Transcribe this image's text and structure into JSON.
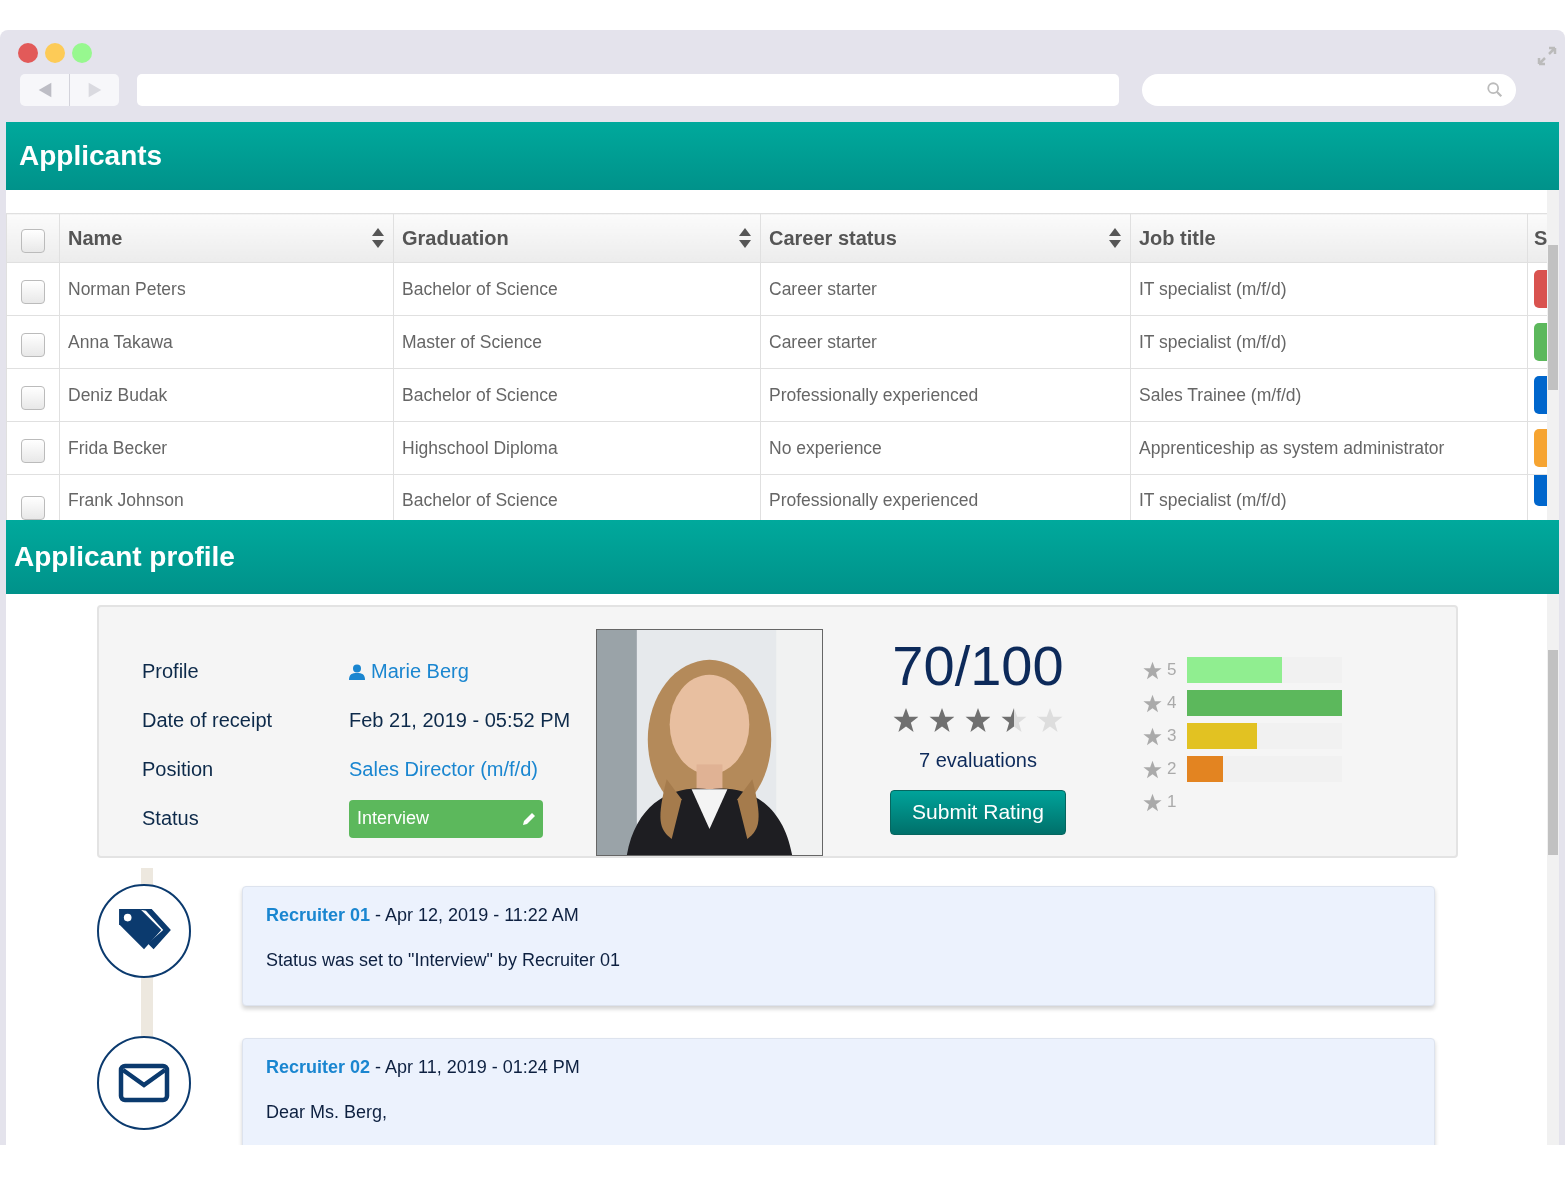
{
  "applicants": {
    "title": "Applicants",
    "columns": [
      {
        "label": "Name",
        "sortable": true
      },
      {
        "label": "Graduation",
        "sortable": true
      },
      {
        "label": "Career status",
        "sortable": true
      },
      {
        "label": "Job title",
        "sortable": false
      },
      {
        "label": "S",
        "sortable": false
      }
    ],
    "header_checkbox": {
      "checked": false
    },
    "rows": [
      {
        "checked": false,
        "name": "Norman Peters",
        "graduation": "Bachelor of Science",
        "career_status": "Career starter",
        "job_title": "IT specialist (m/f/d)",
        "color": "#d9534f"
      },
      {
        "checked": false,
        "name": "Anna Takawa",
        "graduation": "Master of Science",
        "career_status": "Career starter",
        "job_title": "IT specialist (m/f/d)",
        "color": "#5cb85c"
      },
      {
        "checked": false,
        "name": "Deniz Budak",
        "graduation": "Bachelor of Science",
        "career_status": "Professionally experienced",
        "job_title": "Sales Trainee (m/f/d)",
        "color": "#0066cc"
      },
      {
        "checked": false,
        "name": "Frida Becker",
        "graduation": "Highschool Diploma",
        "career_status": "No experience",
        "job_title": "Apprenticeship as system administrator",
        "color": "#f6a431"
      },
      {
        "checked": false,
        "name": "Frank Johnson",
        "graduation": "Bachelor of Science",
        "career_status": "Professionally experienced",
        "job_title": "IT specialist (m/f/d)",
        "color": "#0066cc"
      }
    ]
  },
  "profile": {
    "title": "Applicant profile",
    "fields": [
      {
        "kind": "person_link",
        "label": "Profile",
        "value": "Marie Berg"
      },
      {
        "kind": "text",
        "label": "Date of receipt",
        "value": "Feb 21, 2019 - 05:52 PM"
      },
      {
        "kind": "link",
        "label": "Position",
        "value": "Sales Director (m/f/d)"
      },
      {
        "kind": "status",
        "label": "Status",
        "value": "Interview"
      }
    ],
    "score": "70/100",
    "stars": 3.5,
    "evaluations": "7 evaluations",
    "submit_button": "Submit Rating",
    "distribution": [
      {
        "label": "5",
        "level": 0.61,
        "color": "#90ee90"
      },
      {
        "label": "4",
        "level": 1,
        "color": "#5cb85c"
      },
      {
        "label": "3",
        "level": 0.45,
        "color": "#e2c222"
      },
      {
        "label": "2",
        "level": 0.23,
        "color": "#e38421"
      },
      {
        "label": "1"
      }
    ]
  },
  "timeline": [
    {
      "kind": "tag",
      "author": "Recruiter 01",
      "date": " - Apr 12, 2019 - 11:22 AM",
      "text": "Status was set to \"Interview\" by Recruiter 01"
    },
    {
      "kind": "mail",
      "author": "Recruiter 02",
      "date": " - Apr 11, 2019 - 01:24 PM",
      "text": "Dear Ms. Berg,"
    }
  ]
}
